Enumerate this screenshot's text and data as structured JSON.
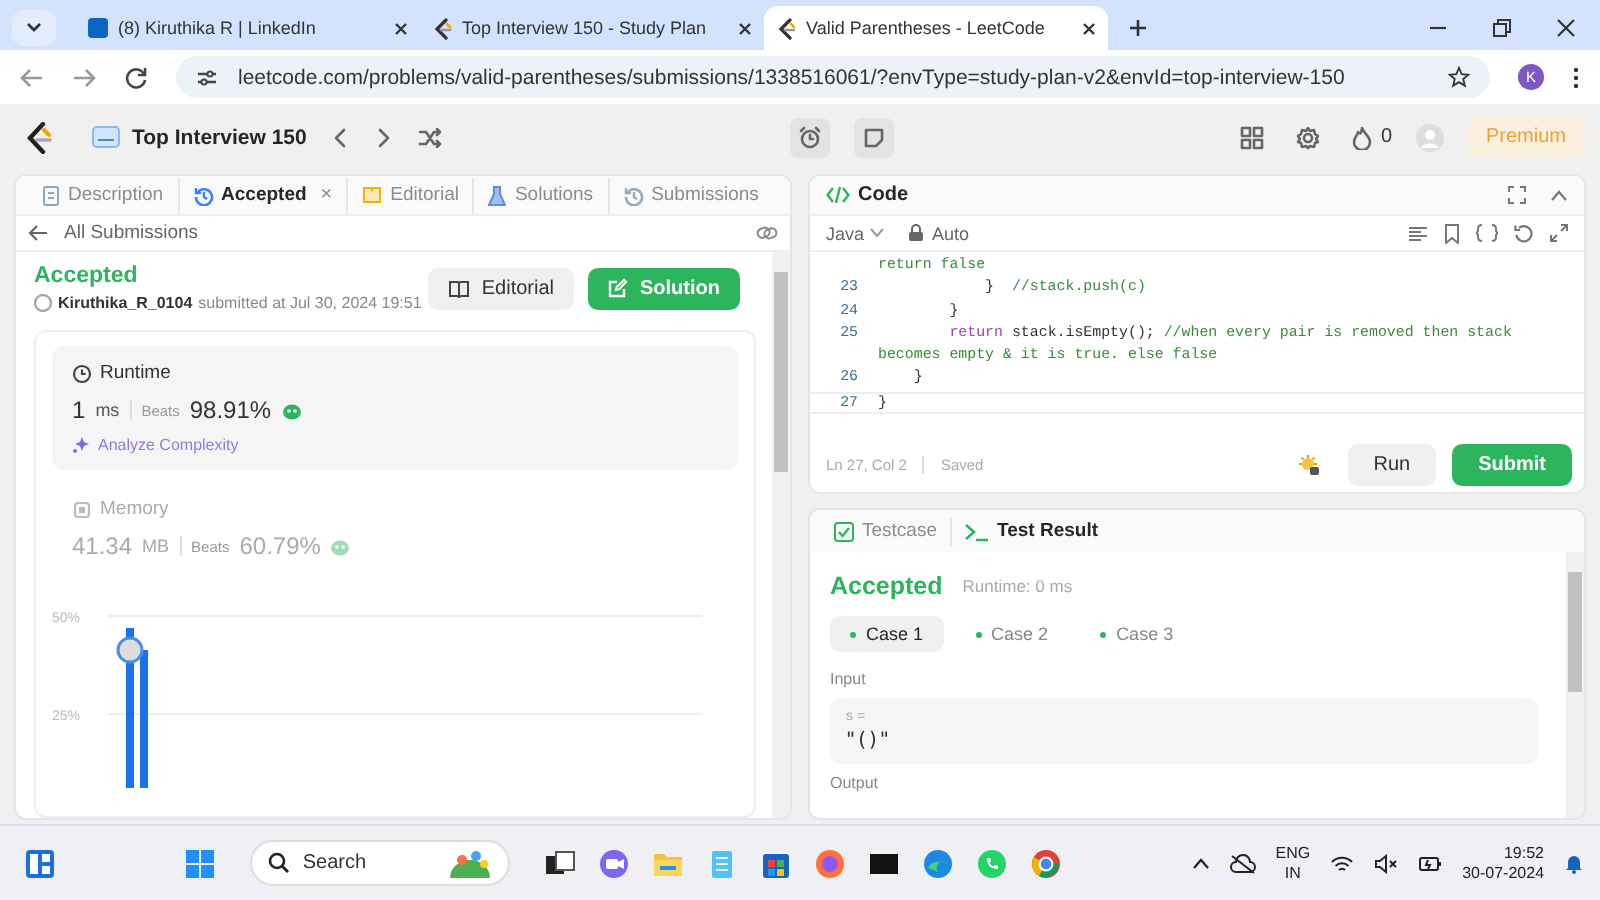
{
  "browser": {
    "tabs": [
      {
        "title": "(8) Kiruthika R | LinkedIn",
        "kind": "social",
        "selected": false
      },
      {
        "title": "Top Interview 150 - Study Plan",
        "kind": "leetcode",
        "selected": false
      },
      {
        "title": "Valid Parentheses - LeetCode",
        "kind": "leetcode",
        "selected": true
      }
    ],
    "url": "leetcode.com/problems/valid-parentheses/submissions/1338516061/?envType=study-plan-v2&envId=top-interview-150",
    "profile": "K"
  },
  "header": {
    "plan_title": "Top Interview 150",
    "streak": "0",
    "premium": "Premium"
  },
  "submission": {
    "tabs": [
      {
        "label": "Description",
        "kind": "doc",
        "selected": false
      },
      {
        "label": "Accepted",
        "kind": "history",
        "selected": true,
        "close": "×"
      },
      {
        "label": "Editorial",
        "kind": "book",
        "selected": false
      },
      {
        "label": "Solutions",
        "kind": "flask",
        "selected": false
      },
      {
        "label": "Submissions",
        "kind": "history",
        "selected": false
      }
    ],
    "back_link": "All Submissions",
    "status": "Accepted",
    "author": "Kiruthika_R_0104",
    "submitted": "submitted at Jul 30, 2024 19:51",
    "buttons": [
      {
        "label": "Editorial",
        "kind": "secondary"
      },
      {
        "label": "Solution",
        "kind": "primary"
      }
    ],
    "stats": [
      {
        "title": "Runtime",
        "kind": "clock",
        "value": "1",
        "unit": "ms",
        "beats_label": "Beats",
        "beats": "98.91%",
        "selected": true,
        "link": "Analyze Complexity"
      },
      {
        "title": "Memory",
        "kind": "chip",
        "value": "41.34",
        "unit": "MB",
        "beats_label": "Beats",
        "beats": "60.79%",
        "selected": false
      }
    ],
    "chart_ticks": [
      "50%",
      "25%"
    ]
  },
  "code": {
    "title": "Code",
    "language": "Java",
    "mode": "Auto",
    "lines": [
      {
        "current": false,
        "tokens": [
          {
            "kind": "comment",
            "text": "return false"
          }
        ]
      },
      {
        "number": "23",
        "current": false,
        "tokens": [
          {
            "kind": "plain",
            "text": "            }  "
          },
          {
            "kind": "comment",
            "text": "//stack.push(c)"
          }
        ]
      },
      {
        "number": "24",
        "current": false,
        "tokens": [
          {
            "kind": "plain",
            "text": "        }"
          }
        ]
      },
      {
        "number": "25",
        "current": false,
        "tokens": [
          {
            "kind": "keyword",
            "text": "        return"
          },
          {
            "kind": "plain",
            "text": " stack.isEmpty(); "
          },
          {
            "kind": "comment",
            "text": "//when every pair is removed then stack"
          }
        ]
      },
      {
        "current": false,
        "tokens": [
          {
            "kind": "comment",
            "text": "becomes empty & it is true. else false"
          }
        ]
      },
      {
        "number": "26",
        "current": false,
        "tokens": [
          {
            "kind": "plain",
            "text": "    }"
          }
        ]
      },
      {
        "number": "27",
        "current": true,
        "tokens": [
          {
            "kind": "plain",
            "text": "}"
          }
        ]
      }
    ],
    "cursor": "Ln 27, Col 2",
    "save_state": "Saved",
    "buttons": [
      {
        "label": "Run",
        "kind": "secondary"
      },
      {
        "label": "Submit",
        "kind": "primary"
      }
    ]
  },
  "result": {
    "tabs": [
      {
        "label": "Testcase",
        "kind": "check",
        "selected": false
      },
      {
        "label": "Test Result",
        "kind": "terminal",
        "selected": true
      }
    ],
    "verdict": "Accepted",
    "runtime": "Runtime: 0 ms",
    "cases": [
      {
        "label": "Case 1",
        "selected": true
      },
      {
        "label": "Case 2",
        "selected": false
      },
      {
        "label": "Case 3",
        "selected": false
      }
    ],
    "input_label": "Input",
    "input_name": "s =",
    "input_value": "\"()\"",
    "output_label": "Output"
  },
  "taskbar": {
    "search": "Search",
    "language": "ENG",
    "region": "IN",
    "time": "19:52",
    "date": "30-07-2024"
  }
}
